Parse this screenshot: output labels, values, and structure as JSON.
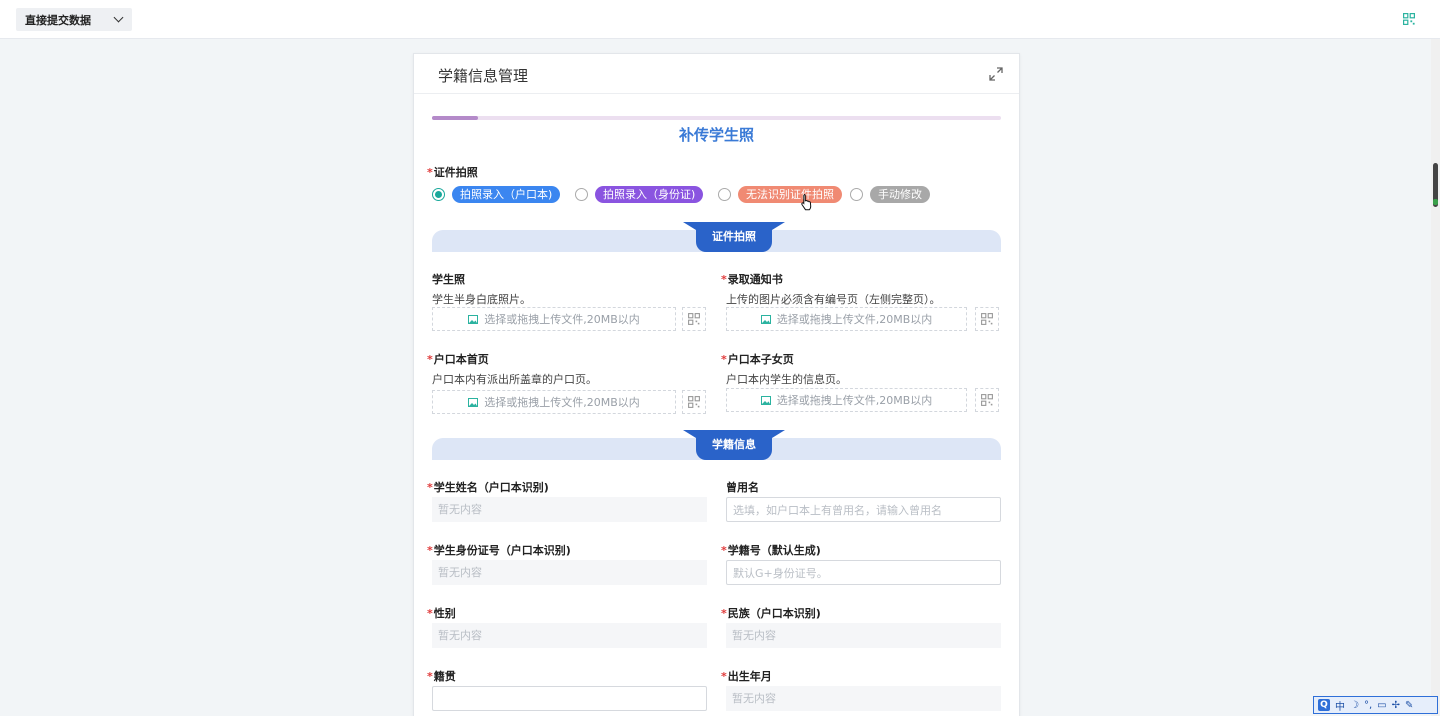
{
  "topbar": {
    "mode_label": "直接提交数据"
  },
  "card": {
    "title": "学籍信息管理",
    "progress": 0.08,
    "section_title": "补传学生照",
    "cert_label": "证件拍照",
    "options": [
      {
        "label": "拍照录入（户口本)",
        "color": "#3b86f0",
        "selected": true
      },
      {
        "label": "拍照录入（身份证)",
        "color": "#8a54e0",
        "selected": false
      },
      {
        "label": "无法识别证件拍照",
        "color": "#f08a73",
        "selected": false
      },
      {
        "label": "手动修改",
        "color": "#a8a8a8",
        "selected": false
      }
    ],
    "banner1": "证件拍照",
    "uploads": [
      {
        "label": "学生照",
        "required": false,
        "hint": "学生半身白底照片。",
        "placeholder": "选择或拖拽上传文件,20MB以内"
      },
      {
        "label": "录取通知书",
        "required": true,
        "hint": "上传的图片必须含有编号页（左侧完整页）。",
        "placeholder": "选择或拖拽上传文件,20MB以内"
      },
      {
        "label": "户口本首页",
        "required": true,
        "hint": "户口本内有派出所盖章的户口页。",
        "placeholder": "选择或拖拽上传文件,20MB以内"
      },
      {
        "label": "户口本子女页",
        "required": true,
        "hint": "户口本内学生的信息页。",
        "placeholder": "选择或拖拽上传文件,20MB以内"
      }
    ],
    "banner2": "学籍信息",
    "fields": [
      {
        "label": "学生姓名（户口本识别)",
        "required": true,
        "value": "暂无内容"
      },
      {
        "label": "曾用名",
        "required": false,
        "value": "选填，如户口本上有曾用名，请输入曾用名"
      },
      {
        "label": "学生身份证号（户口本识别)",
        "required": true,
        "value": "暂无内容"
      },
      {
        "label": "学籍号（默认生成)",
        "required": true,
        "value": "默认G+身份证号。"
      },
      {
        "label": "性别",
        "required": true,
        "value": "暂无内容"
      },
      {
        "label": "民族（户口本识别)",
        "required": true,
        "value": "暂无内容"
      },
      {
        "label": "籍贯",
        "required": true,
        "value": ""
      },
      {
        "label": "出生年月",
        "required": true,
        "value": "暂无内容"
      }
    ],
    "required_mark": "*"
  },
  "ime": {
    "logo": "Q",
    "lang": "中"
  },
  "colors": {
    "accent": "#2a63c9",
    "title_blue": "#3a7ad6",
    "required": "#e03b3b"
  }
}
